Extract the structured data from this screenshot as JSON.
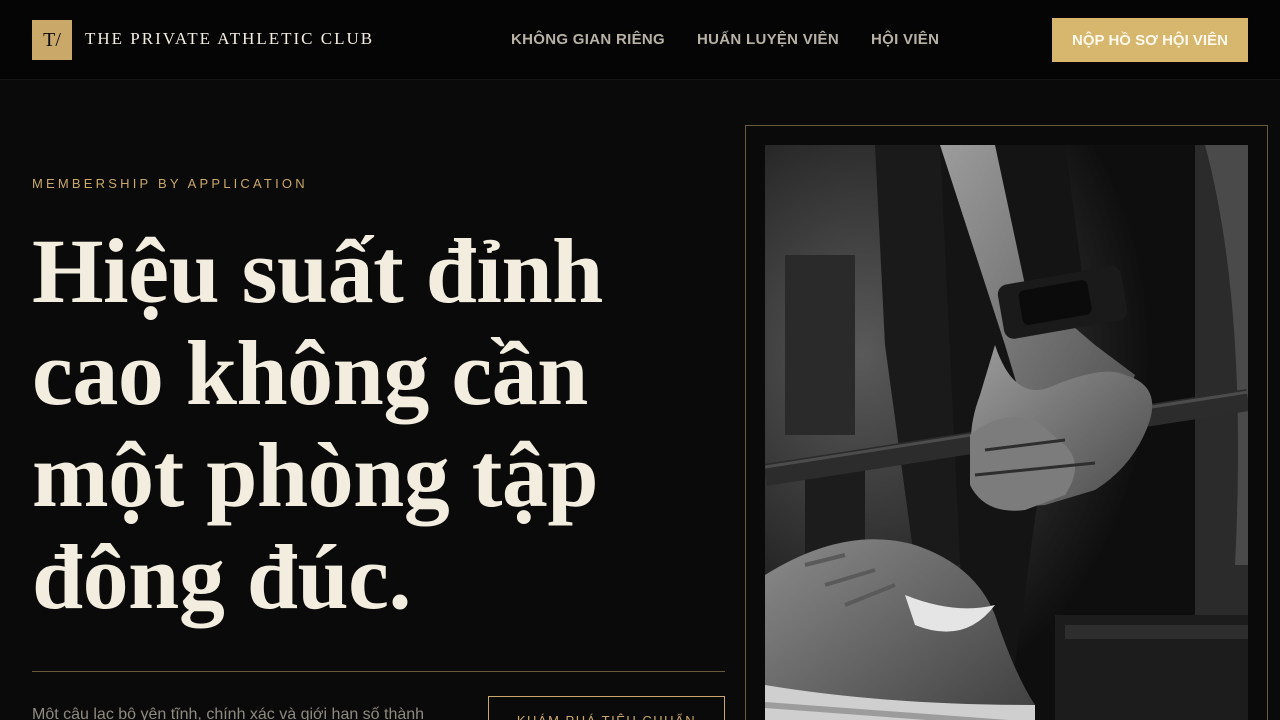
{
  "header": {
    "logo_mark": "T/",
    "brand": "THE PRIVATE ATHLETIC CLUB",
    "nav": [
      "KHÔNG GIAN RIÊNG",
      "HUẤN LUYỆN VIÊN",
      "HỘI VIÊN"
    ],
    "cta": "NỘP HỒ SƠ HỘI VIÊN"
  },
  "hero": {
    "eyebrow": "MEMBERSHIP BY APPLICATION",
    "headline": "Hiệu suất đỉnh cao không cần một phòng tập đông đúc.",
    "intro": "Một câu lạc bộ yên tĩnh, chính xác và giới hạn số thành",
    "cta": "KHÁM PHÁ TIÊU CHUẨN"
  },
  "colors": {
    "background": "#0a0a0a",
    "accent": "#c9a86a",
    "cta": "#d7b66e",
    "text": "#f3ede0"
  }
}
